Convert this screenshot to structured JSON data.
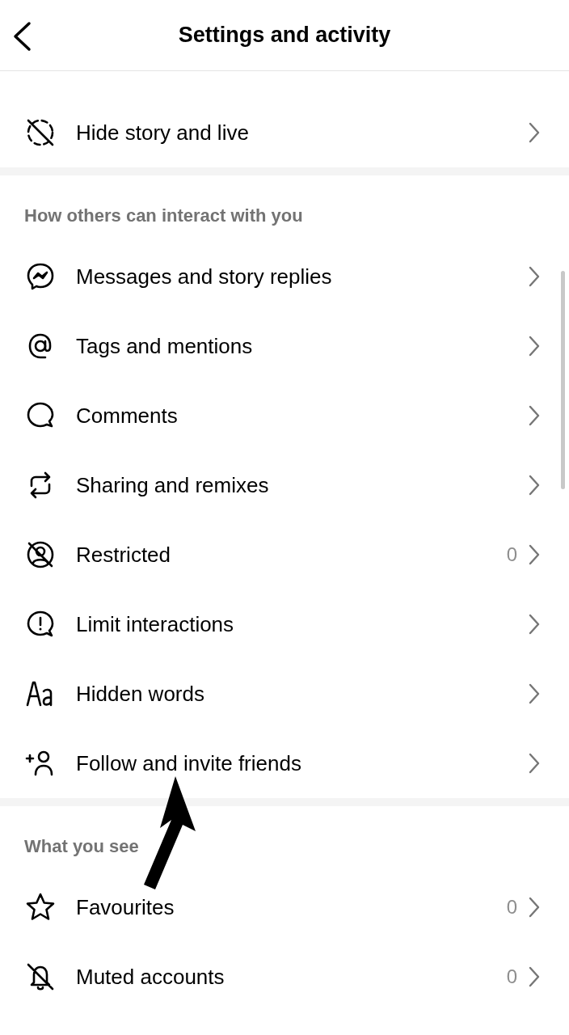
{
  "header": {
    "title": "Settings and activity"
  },
  "sections": [
    {
      "items": [
        {
          "label": "Hide story and live"
        }
      ]
    },
    {
      "title": "How others can interact with you",
      "items": [
        {
          "label": "Messages and story replies"
        },
        {
          "label": "Tags and mentions"
        },
        {
          "label": "Comments"
        },
        {
          "label": "Sharing and remixes"
        },
        {
          "label": "Restricted",
          "count": "0"
        },
        {
          "label": "Limit interactions"
        },
        {
          "label": "Hidden words"
        },
        {
          "label": "Follow and invite friends"
        }
      ]
    },
    {
      "title": "What you see",
      "items": [
        {
          "label": "Favourites",
          "count": "0"
        },
        {
          "label": "Muted accounts",
          "count": "0"
        }
      ]
    }
  ]
}
